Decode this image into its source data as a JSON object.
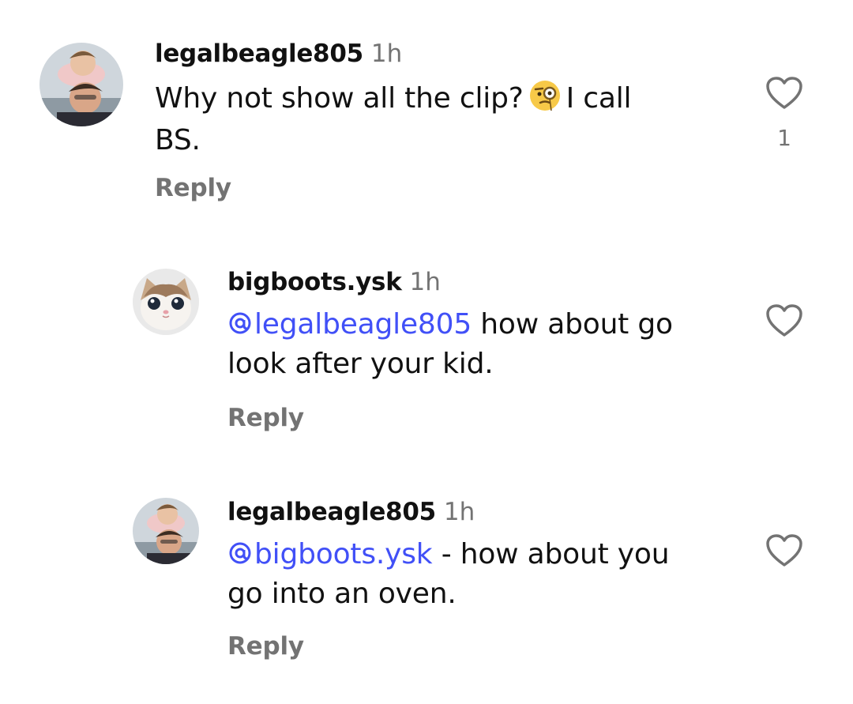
{
  "comments": [
    {
      "username": "legalbeagle805",
      "time": "1h",
      "text_before": "Why not show all the clip?",
      "emoji": "face-with-monocle-icon",
      "text_after_1": "I call",
      "text_after_2": "BS.",
      "reply_label": "Reply",
      "like_count": "1",
      "avatar": "father-and-child-photo"
    },
    {
      "username": "bigboots.ysk",
      "time": "1h",
      "mention": "legalbeagle805",
      "text_1": "how about go",
      "text_2": "look after your kid.",
      "reply_label": "Reply",
      "avatar": "kitten-photo"
    },
    {
      "username": "legalbeagle805",
      "time": "1h",
      "mention": "bigboots.ysk",
      "text_1": "- how about you",
      "text_2": "go into an oven.",
      "reply_label": "Reply",
      "avatar": "father-and-child-photo"
    }
  ],
  "colors": {
    "mention": "#4150f7",
    "secondary_text": "#737373",
    "primary_text": "#111111"
  }
}
